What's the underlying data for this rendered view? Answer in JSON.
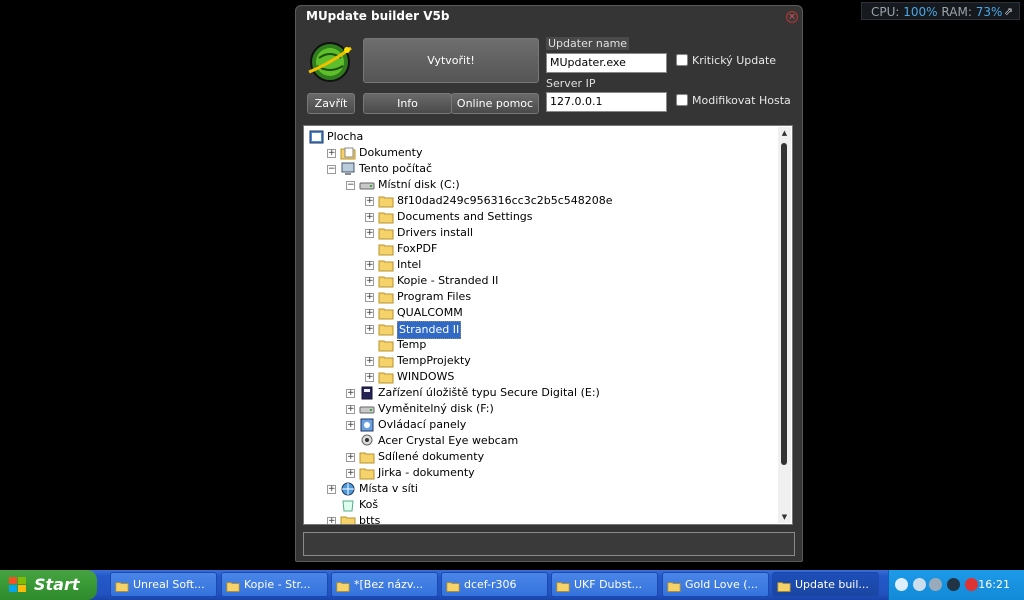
{
  "widget": {
    "cpu_label": "CPU:",
    "cpu_value": "100%",
    "ram_label": "RAM:",
    "ram_value": "73%"
  },
  "window": {
    "title": "MUpdate builder V5b",
    "buttons": {
      "create": "Vytvořit!",
      "close": "Zavřít",
      "info": "Info",
      "help": "Online pomoc"
    },
    "fields": {
      "name_label": "Updater name",
      "name_value": "MUpdater.exe",
      "ip_label": "Server IP",
      "ip_value": "127.0.0.1"
    },
    "checks": {
      "critical": "Kritický Update",
      "host": "Modifikovat Hosta"
    }
  },
  "tree": [
    {
      "label": "Plocha",
      "icon": "desktop-icon"
    },
    {
      "label": "Dokumenty",
      "icon": "documents-icon"
    },
    {
      "label": "Tento počítač",
      "icon": "computer-icon"
    },
    {
      "label": "Místní disk (C:)",
      "icon": "drive-icon"
    },
    {
      "label": "8f10dad249c956316cc3c2b5c548208e",
      "icon": "folder-icon"
    },
    {
      "label": "Documents and Settings",
      "icon": "folder-icon"
    },
    {
      "label": "Drivers install",
      "icon": "folder-icon"
    },
    {
      "label": "FoxPDF",
      "icon": "folder-icon"
    },
    {
      "label": "Intel",
      "icon": "folder-icon"
    },
    {
      "label": "Kopie - Stranded II",
      "icon": "folder-icon"
    },
    {
      "label": "Program Files",
      "icon": "folder-icon"
    },
    {
      "label": "QUALCOMM",
      "icon": "folder-icon"
    },
    {
      "label": "Stranded II",
      "icon": "folder-icon"
    },
    {
      "label": "Temp",
      "icon": "folder-icon"
    },
    {
      "label": "TempProjekty",
      "icon": "folder-icon"
    },
    {
      "label": "WINDOWS",
      "icon": "folder-icon"
    },
    {
      "label": "Zařízení úložiště typu Secure Digital (E:)",
      "icon": "sd-card-icon"
    },
    {
      "label": "Vyměnitelný disk (F:)",
      "icon": "drive-icon"
    },
    {
      "label": "Ovládací panely",
      "icon": "control-panel-icon"
    },
    {
      "label": "Acer Crystal Eye webcam",
      "icon": "webcam-icon"
    },
    {
      "label": "Sdílené dokumenty",
      "icon": "folder-icon"
    },
    {
      "label": "Jirka - dokumenty",
      "icon": "folder-icon"
    },
    {
      "label": "Místa v síti",
      "icon": "network-icon"
    },
    {
      "label": "Koš",
      "icon": "recycle-bin-icon"
    },
    {
      "label": "btts",
      "icon": "folder-icon"
    }
  ],
  "taskbar": {
    "start": "Start",
    "tasks": [
      {
        "label": "Unreal Soft...",
        "icon": "chrome-icon"
      },
      {
        "label": "Kopie - Str...",
        "icon": "folder-icon"
      },
      {
        "label": "*[Bez názv...",
        "icon": "editor-icon"
      },
      {
        "label": "dcef-r306",
        "icon": "folder-icon"
      },
      {
        "label": "UKF Dubst...",
        "icon": "folder-icon"
      },
      {
        "label": "Gold Love (...",
        "icon": "app-icon"
      },
      {
        "label": "Update buil...",
        "icon": "globe-icon"
      }
    ],
    "clock": "16:21"
  }
}
